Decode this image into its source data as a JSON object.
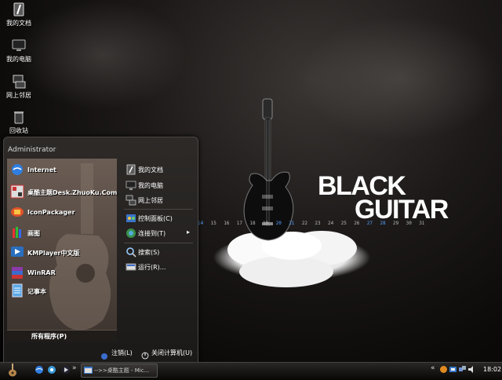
{
  "desktop": {
    "icons": [
      {
        "label": "我的文档",
        "icon": "my-documents-icon"
      },
      {
        "label": "我的电脑",
        "icon": "my-computer-icon"
      },
      {
        "label": "网上邻居",
        "icon": "network-places-icon"
      },
      {
        "label": "回收站",
        "icon": "recycle-bin-icon"
      }
    ],
    "wallpaper": {
      "title_line1": "BLACK",
      "title_line2": "GUITAR",
      "dates": [
        "14",
        "15",
        "16",
        "17",
        "18",
        "19",
        "20",
        "21",
        "22",
        "23",
        "24",
        "25",
        "26",
        "27",
        "28",
        "29",
        "30",
        "31"
      ],
      "highlight_dates": [
        "14",
        "20",
        "21",
        "27",
        "28"
      ]
    }
  },
  "start_menu": {
    "user": "Administrator",
    "programs": [
      {
        "label": "Internet",
        "icon": "internet-explorer-icon"
      },
      {
        "label": "桌酷主题Desk.ZhuoKu.Com",
        "icon": "zhuoku-theme-icon"
      },
      {
        "label": "IconPackager",
        "icon": "iconpackager-icon"
      },
      {
        "label": "画图",
        "icon": "paint-icon"
      },
      {
        "label": "KMPlayer中文版",
        "icon": "kmplayer-icon"
      },
      {
        "label": "WinRAR",
        "icon": "winrar-icon"
      },
      {
        "label": "记事本",
        "icon": "notepad-icon"
      }
    ],
    "all_programs": "所有程序(P)",
    "places": [
      {
        "label": "我的文档",
        "icon": "my-documents-icon"
      },
      {
        "label": "我的电脑",
        "icon": "my-computer-icon"
      },
      {
        "label": "网上邻居",
        "icon": "network-places-icon"
      },
      {
        "label": "控制面板(C)",
        "icon": "control-panel-icon"
      },
      {
        "label": "连接到(T)",
        "icon": "connect-to-icon",
        "has_submenu": true
      },
      {
        "label": "搜索(S)",
        "icon": "search-icon"
      },
      {
        "label": "运行(R)...",
        "icon": "run-icon"
      }
    ],
    "logoff": "注销(L)",
    "shutdown": "关闭计算机(U)"
  },
  "taskbar": {
    "task_title": "-->>桌酷主题 - Mic...",
    "clock": "18:02"
  },
  "colors": {
    "highlight_date": "#5aa0ff",
    "menu_left_panel": "#5a4d46"
  }
}
